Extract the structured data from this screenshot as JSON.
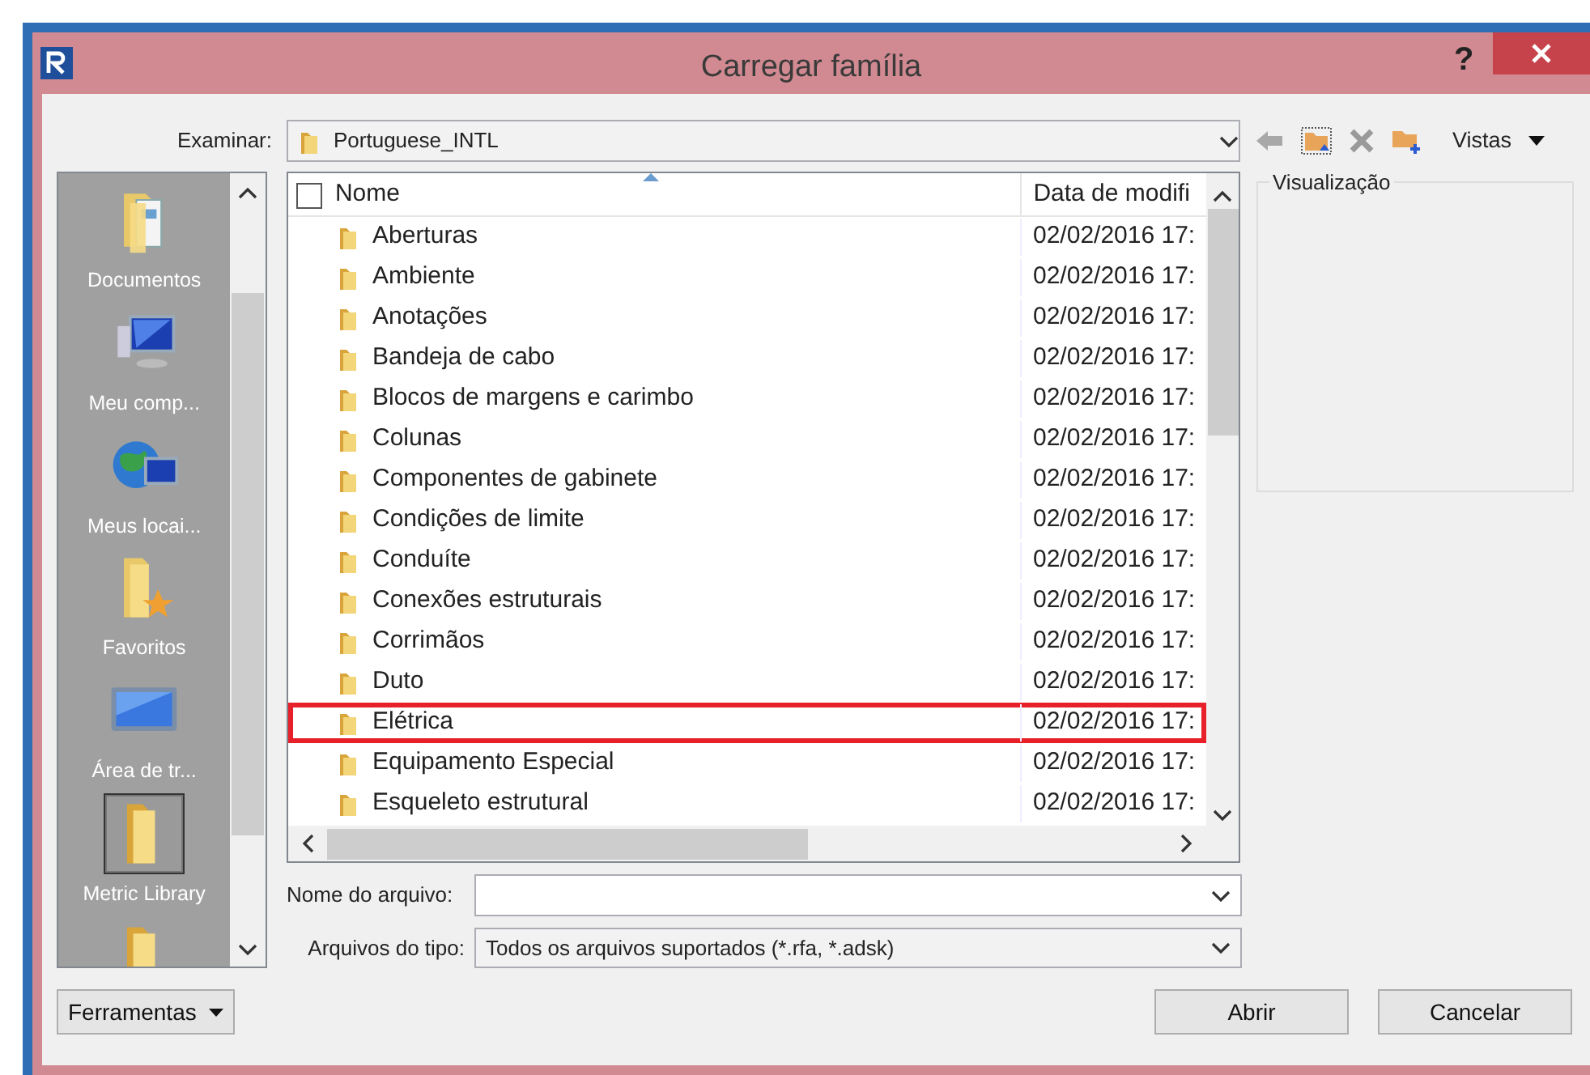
{
  "window": {
    "title": "Carregar família",
    "help": "?"
  },
  "look_in": {
    "label": "Examinar:",
    "value": "Portuguese_INTL"
  },
  "toolbar": {
    "views_label": "Vistas"
  },
  "places": [
    {
      "label": "Documentos",
      "kind": "documents",
      "selected": false
    },
    {
      "label": "Meu comp...",
      "kind": "computer",
      "selected": false
    },
    {
      "label": "Meus locai...",
      "kind": "network",
      "selected": false
    },
    {
      "label": "Favoritos",
      "kind": "favorites",
      "selected": false
    },
    {
      "label": "Área de tr...",
      "kind": "desktop",
      "selected": false
    },
    {
      "label": "Metric Library",
      "kind": "folder",
      "selected": true
    },
    {
      "kind": "folder",
      "selected": false
    }
  ],
  "file_list": {
    "header_checked": false,
    "columns": [
      {
        "label": "Nome",
        "sorted": true
      },
      {
        "label": "Data de modifi",
        "sorted": false
      }
    ],
    "rows": [
      {
        "name": "Aberturas",
        "date": "02/02/2016 17:",
        "highlighted": false
      },
      {
        "name": "Ambiente",
        "date": "02/02/2016 17:",
        "highlighted": false
      },
      {
        "name": "Anotações",
        "date": "02/02/2016 17:",
        "highlighted": false
      },
      {
        "name": "Bandeja de cabo",
        "date": "02/02/2016 17:",
        "highlighted": false
      },
      {
        "name": "Blocos de margens e carimbo",
        "date": "02/02/2016 17:",
        "highlighted": false
      },
      {
        "name": "Colunas",
        "date": "02/02/2016 17:",
        "highlighted": false
      },
      {
        "name": "Componentes de gabinete",
        "date": "02/02/2016 17:",
        "highlighted": false
      },
      {
        "name": "Condições de limite",
        "date": "02/02/2016 17:",
        "highlighted": false
      },
      {
        "name": "Conduíte",
        "date": "02/02/2016 17:",
        "highlighted": false
      },
      {
        "name": "Conexões estruturais",
        "date": "02/02/2016 17:",
        "highlighted": false
      },
      {
        "name": "Corrimãos",
        "date": "02/02/2016 17:",
        "highlighted": false
      },
      {
        "name": "Duto",
        "date": "02/02/2016 17:",
        "highlighted": false
      },
      {
        "name": "Elétrica",
        "date": "02/02/2016 17:",
        "highlighted": true
      },
      {
        "name": "Equipamento Especial",
        "date": "02/02/2016 17:",
        "highlighted": false
      },
      {
        "name": "Esqueleto estrutural",
        "date": "02/02/2016 17:",
        "highlighted": false
      }
    ]
  },
  "preview": {
    "label": "Visualização"
  },
  "file_name": {
    "label": "Nome do arquivo:"
  },
  "file_type": {
    "label": "Arquivos do tipo:",
    "value": "Todos os arquivos suportados  (*.rfa, *.adsk)"
  },
  "buttons": {
    "tools": "Ferramentas",
    "open": "Abrir",
    "cancel": "Cancelar"
  }
}
